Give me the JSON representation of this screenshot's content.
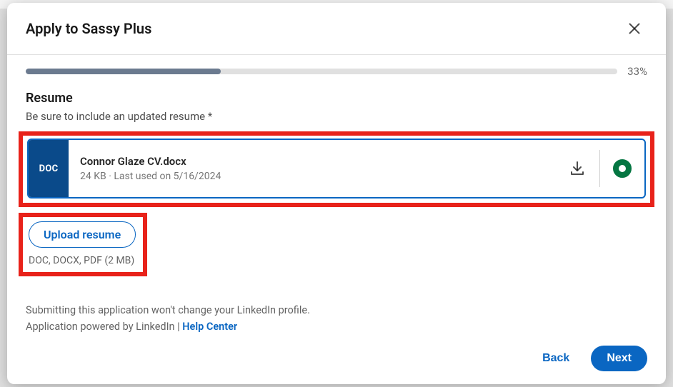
{
  "modal": {
    "title": "Apply to Sassy Plus",
    "progress_percent": 33,
    "progress_label": "33%"
  },
  "resume_section": {
    "title": "Resume",
    "hint": "Be sure to include an updated resume *"
  },
  "resume_card": {
    "badge": "DOC",
    "filename": "Connor Glaze CV.docx",
    "meta": "24 KB · Last used on 5/16/2024",
    "selected": true
  },
  "upload": {
    "button_label": "Upload resume",
    "hint": "DOC, DOCX, PDF (2 MB)"
  },
  "disclaimer": {
    "line1": "Submitting this application won't change your LinkedIn profile.",
    "line2_prefix": "Application powered by LinkedIn",
    "separator": " | ",
    "help_link": "Help Center"
  },
  "footer": {
    "back_label": "Back",
    "next_label": "Next"
  }
}
